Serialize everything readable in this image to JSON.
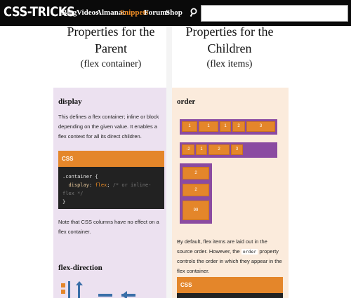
{
  "nav": {
    "logo": "CSS-TRICKS",
    "items": [
      {
        "label": "Blog",
        "active": false
      },
      {
        "label": "Videos",
        "active": false
      },
      {
        "label": "Almanac",
        "active": false
      },
      {
        "label": "Snippets",
        "active": true
      },
      {
        "label": "Forums",
        "active": false
      },
      {
        "label": "Shop",
        "active": false
      }
    ],
    "search_placeholder": ""
  },
  "left": {
    "heading_line1": "Properties for the",
    "heading_line2": "Parent",
    "heading_sub": "(flex container)",
    "display": {
      "title": "display",
      "description": "This defines a flex container; inline or block depending on the given value. It enables a flex context for all its direct children.",
      "code_label": "CSS",
      "code_line1": ".container {",
      "code_prop": "display",
      "code_val": "flex",
      "code_comment": "/* or inline-flex */",
      "code_close": "}",
      "note": "Note that CSS columns have no effect on a flex container."
    },
    "flex_direction": {
      "title": "flex-direction"
    }
  },
  "right": {
    "heading_line1": "Properties for the",
    "heading_line2": "Children",
    "heading_sub": "(flex items)",
    "order": {
      "title": "order",
      "row1": [
        "1",
        "1",
        "1",
        "2",
        "3"
      ],
      "row2": [
        "-2",
        "1",
        "2",
        "3"
      ],
      "column": [
        "2",
        "2",
        "99"
      ],
      "desc_before": "By default, flex items are laid out in the source order. However, the",
      "desc_code": "order",
      "desc_after": "property controls the order in which they appear in the flex container.",
      "code_label": "CSS"
    }
  },
  "colors": {
    "accent": "#f08d24",
    "purple": "#8b4ba1",
    "lavender": "#ece1f0",
    "peach": "#fbebdc",
    "codebg": "#222222",
    "arrow_blue": "#3a6fa8"
  }
}
